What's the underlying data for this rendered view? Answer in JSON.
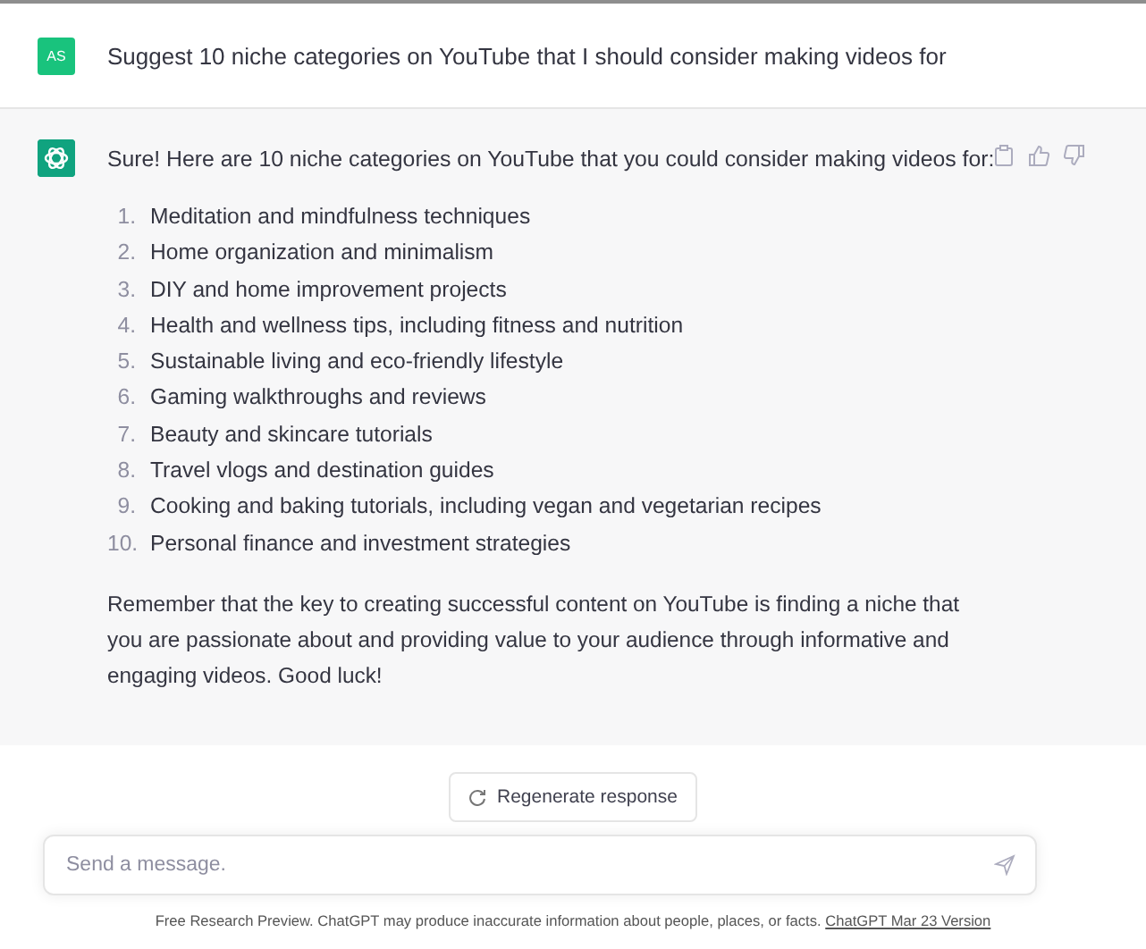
{
  "user_message": {
    "avatar": "AS",
    "text": "Suggest 10 niche categories on YouTube that I should consider making videos for"
  },
  "assistant_message": {
    "intro": "Sure! Here are 10 niche categories on YouTube that you could consider making videos for:",
    "items": [
      {
        "number": "1.",
        "text": "Meditation and mindfulness techniques"
      },
      {
        "number": "2.",
        "text": "Home organization and minimalism"
      },
      {
        "number": "3.",
        "text": "DIY and home improvement projects"
      },
      {
        "number": "4.",
        "text": "Health and wellness tips, including fitness and nutrition"
      },
      {
        "number": "5.",
        "text": "Sustainable living and eco-friendly lifestyle"
      },
      {
        "number": "6.",
        "text": "Gaming walkthroughs and reviews"
      },
      {
        "number": "7.",
        "text": "Beauty and skincare tutorials"
      },
      {
        "number": "8.",
        "text": "Travel vlogs and destination guides"
      },
      {
        "number": "9.",
        "text": "Cooking and baking tutorials, including vegan and vegetarian recipes"
      },
      {
        "number": "10.",
        "text": "Personal finance and investment strategies"
      }
    ],
    "closing": "Remember that the key to creating successful content on YouTube is finding a niche that you are passionate about and providing value to your audience through informative and engaging videos. Good luck!"
  },
  "regenerate_button": "Regenerate response",
  "message_input": {
    "placeholder": "Send a message."
  },
  "footer": {
    "text": "Free Research Preview. ChatGPT may produce inaccurate information about people, places, or facts.",
    "link": "ChatGPT Mar 23 Version"
  }
}
